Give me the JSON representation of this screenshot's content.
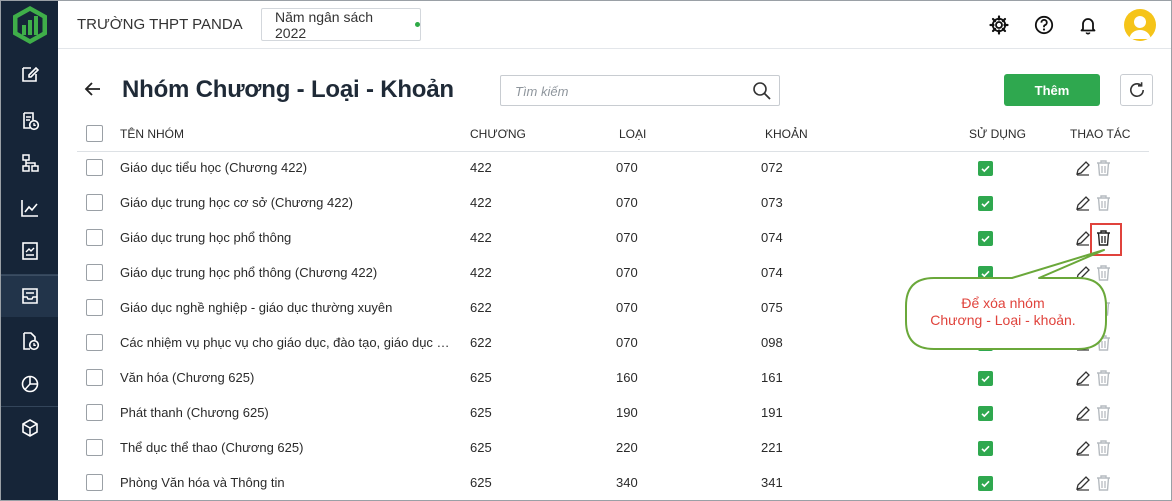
{
  "header": {
    "school": "TRƯỜNG THPT PANDA",
    "budget_year": "Năm ngân sách 2022",
    "status_color": "#2eaa46"
  },
  "sidebar": {
    "items": [
      {
        "icon": "edit-note-icon"
      },
      {
        "icon": "receipt-clock-icon"
      },
      {
        "icon": "org-chart-icon"
      },
      {
        "icon": "line-chart-icon"
      },
      {
        "icon": "report-chart-icon"
      },
      {
        "icon": "inbox-icon",
        "active": true
      },
      {
        "icon": "document-clock-icon"
      },
      {
        "icon": "pie-chart-icon"
      },
      {
        "icon": "cube-icon"
      }
    ]
  },
  "page": {
    "title": "Nhóm Chương - Loại - Khoản",
    "search_placeholder": "Tìm kiếm",
    "add_label": "Thêm"
  },
  "table": {
    "columns": {
      "name": "TÊN NHÓM",
      "chuong": "CHƯƠNG",
      "loai": "LOẠI",
      "khoan": "KHOẢN",
      "su_dung": "SỬ DỤNG",
      "thao_tac": "THAO TÁC"
    },
    "rows": [
      {
        "name": "Giáo dục tiểu học (Chương 422)",
        "chuong": "422",
        "loai": "070",
        "khoan": "072",
        "used": true
      },
      {
        "name": "Giáo dục trung học cơ sở (Chương 422)",
        "chuong": "422",
        "loai": "070",
        "khoan": "073",
        "used": true
      },
      {
        "name": "Giáo dục trung học phổ thông",
        "chuong": "422",
        "loai": "070",
        "khoan": "074",
        "used": true
      },
      {
        "name": "Giáo dục trung học phổ thông (Chương 422)",
        "chuong": "422",
        "loai": "070",
        "khoan": "074",
        "used": true
      },
      {
        "name": "Giáo dục nghề nghiệp - giáo dục thường xuyên",
        "chuong": "622",
        "loai": "070",
        "khoan": "075",
        "used": true
      },
      {
        "name": "Các nhiệm vụ phục vụ cho giáo dục, đào tạo, giáo dục n...",
        "chuong": "622",
        "loai": "070",
        "khoan": "098",
        "used": true
      },
      {
        "name": "Văn hóa (Chương 625)",
        "chuong": "625",
        "loai": "160",
        "khoan": "161",
        "used": true
      },
      {
        "name": "Phát thanh (Chương 625)",
        "chuong": "625",
        "loai": "190",
        "khoan": "191",
        "used": true
      },
      {
        "name": "Thể dục thể thao (Chương 625)",
        "chuong": "625",
        "loai": "220",
        "khoan": "221",
        "used": true
      },
      {
        "name": "Phòng Văn hóa và Thông tin",
        "chuong": "625",
        "loai": "340",
        "khoan": "341",
        "used": true
      }
    ]
  },
  "callout": {
    "line1": "Để xóa nhóm",
    "line2": "Chương - Loại - khoản.",
    "border_color": "#6aa83a",
    "text_color": "#e0433c"
  }
}
